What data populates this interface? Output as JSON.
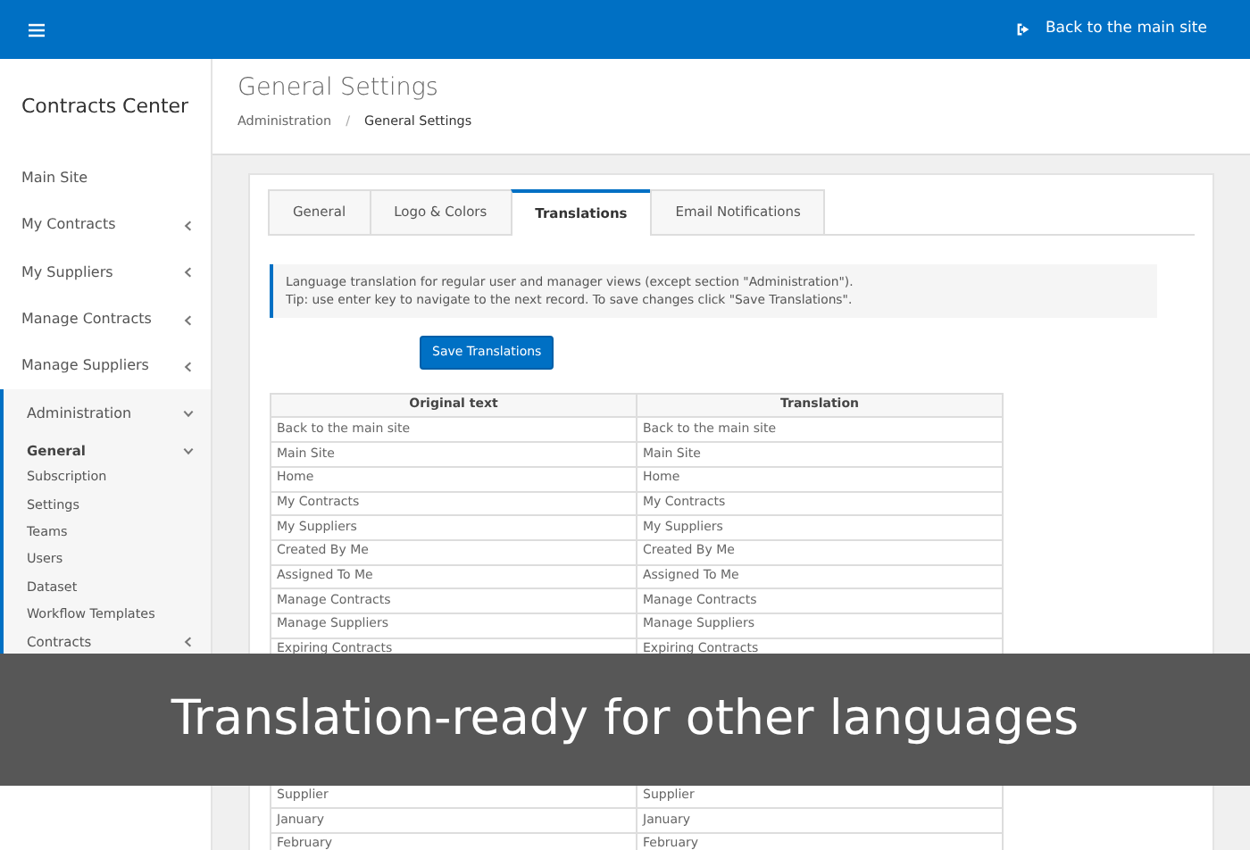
{
  "topbar": {
    "back_link": "Back to the main site"
  },
  "sidebar": {
    "brand": "Contracts Center",
    "items": [
      {
        "label": "Main Site"
      },
      {
        "label": "My Contracts",
        "expanded": false
      },
      {
        "label": "My Suppliers",
        "expanded": false
      },
      {
        "label": "Manage Contracts",
        "expanded": false
      },
      {
        "label": "Manage Suppliers",
        "expanded": false
      },
      {
        "label": "Administration",
        "expanded": true,
        "children": [
          {
            "label": "General",
            "expanded": true,
            "children": [
              {
                "label": "Subscription"
              },
              {
                "label": "Settings"
              },
              {
                "label": "Teams"
              },
              {
                "label": "Users"
              },
              {
                "label": "Dataset"
              },
              {
                "label": "Workflow Templates"
              }
            ]
          },
          {
            "label": "Contracts",
            "expanded": false
          }
        ]
      }
    ]
  },
  "page": {
    "title": "General Settings",
    "breadcrumb": [
      {
        "label": "Administration"
      },
      {
        "label": "General Settings"
      }
    ],
    "breadcrumb_separator": "/"
  },
  "tabs": [
    {
      "label": "General",
      "selected": false
    },
    {
      "label": "Logo & Colors",
      "selected": false
    },
    {
      "label": "Translations",
      "selected": true
    },
    {
      "label": "Email Notifications",
      "selected": false
    }
  ],
  "info": [
    "Language translation for regular user and manager views (except section \"Administration\").",
    "Tip: use enter key to navigate to the next record. To save changes click \"Save Translations\"."
  ],
  "save_button": "Save Translations",
  "table": {
    "columns": [
      "Original text",
      "Translation"
    ],
    "rows_above_caption": [
      [
        "Back to the main site",
        "Back to the main site"
      ],
      [
        "Main Site",
        "Main Site"
      ],
      [
        "Home",
        "Home"
      ],
      [
        "My Contracts",
        "My Contracts"
      ],
      [
        "My Suppliers",
        "My Suppliers"
      ],
      [
        "Created By Me",
        "Created By Me"
      ],
      [
        "Assigned To Me",
        "Assigned To Me"
      ],
      [
        "Manage Contracts",
        "Manage Contracts"
      ],
      [
        "Manage Suppliers",
        "Manage Suppliers"
      ],
      [
        "Expiring Contracts",
        "Expiring Contracts"
      ]
    ],
    "rows_below_caption": [
      [
        "Supplier",
        "Supplier"
      ],
      [
        "January",
        "January"
      ],
      [
        "February",
        "February"
      ]
    ]
  },
  "caption": "Translation-ready for other languages"
}
